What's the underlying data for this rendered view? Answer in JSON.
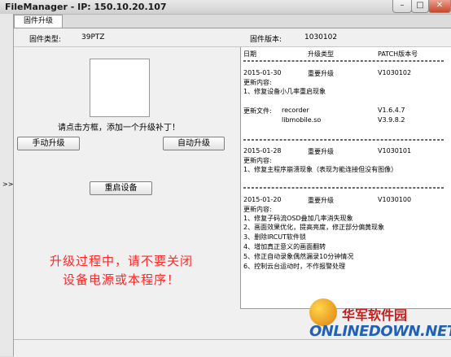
{
  "window": {
    "title": "FileManager - IP: 150.10.20.107"
  },
  "tab": {
    "label": "固件升级"
  },
  "info": {
    "type_label": "固件类型:",
    "type_value": "39PTZ",
    "version_label": "固件版本:",
    "version_value": "1030102"
  },
  "hint": "请点击方框，添加一个升级补丁！",
  "buttons": {
    "manual": "手动升级",
    "auto": "自动升级",
    "reboot": "重启设备"
  },
  "warning": {
    "line1": "升级过程中，请不要关闭",
    "line2": "设备电源或本程序！"
  },
  "changelog": {
    "headers": {
      "date": "日期",
      "type": "升级类型",
      "patch": "PATCH版本号"
    },
    "e1": {
      "date": "2015-01-30",
      "type": "重要升级",
      "ver": "V1030102",
      "content_label": "更新内容:",
      "item1": "1、修复设备小几率重启现象",
      "files_label": "更新文件:",
      "file1": "recorder",
      "file1_ver": "V1.6.4.7",
      "file2": "libmobile.so",
      "file2_ver": "V3.9.8.2"
    },
    "e2": {
      "date": "2015-01-28",
      "type": "重要升级",
      "ver": "V1030101",
      "content_label": "更新内容:",
      "item1": "1、修复主程序崩溃现象（表现为能连接但没有图像）"
    },
    "e3": {
      "date": "2015-01-20",
      "type": "重要升级",
      "ver": "V1030100",
      "content_label": "更新内容:",
      "item1": "1、修复子码流OSD叠加几率消失现象",
      "item2": "2、画面效果优化，提高亮度，修正部分偏黄现象",
      "item3": "3、删除IRCUT软件锁",
      "item4": "4、增加真正意义的画面翻转",
      "item5": "5、修正自动录象偶然漏录10分钟情况",
      "item6": "6、控制云台运动时，不作报警处理"
    }
  },
  "sidebar": {
    "expand": ">>"
  },
  "watermark": {
    "line1": "华军软件园",
    "line2": "ONLINEDOWN.NET"
  }
}
